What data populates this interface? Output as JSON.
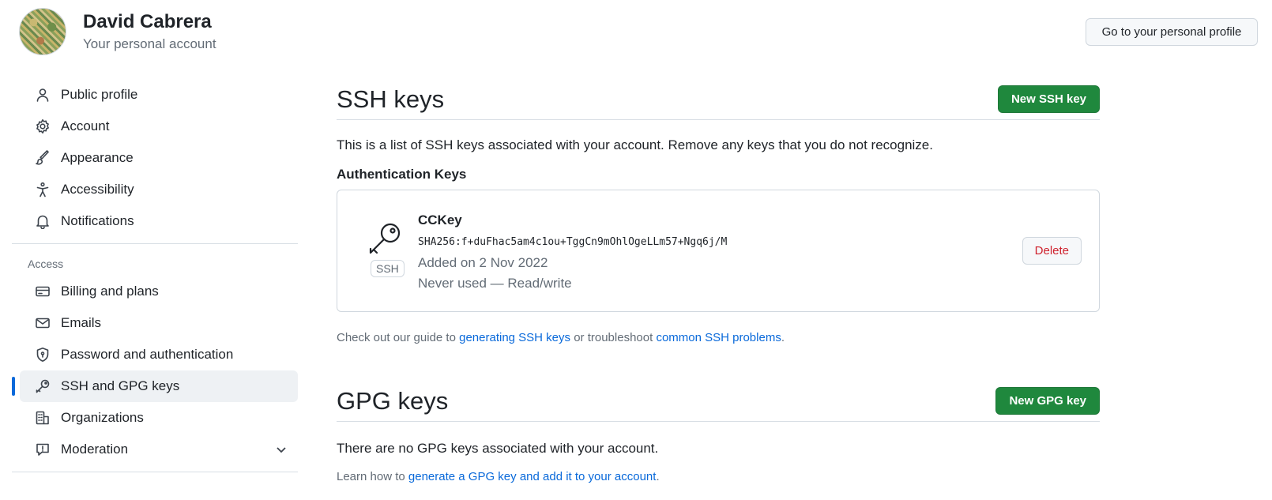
{
  "header": {
    "name": "David Cabrera",
    "subtitle": "Your personal account",
    "profile_button": "Go to your personal profile"
  },
  "sidebar": {
    "items": [
      {
        "label": "Public profile",
        "icon": "person-icon"
      },
      {
        "label": "Account",
        "icon": "gear-icon"
      },
      {
        "label": "Appearance",
        "icon": "paintbrush-icon"
      },
      {
        "label": "Accessibility",
        "icon": "accessibility-icon"
      },
      {
        "label": "Notifications",
        "icon": "bell-icon"
      }
    ],
    "access_heading": "Access",
    "access_items": [
      {
        "label": "Billing and plans",
        "icon": "credit-card-icon"
      },
      {
        "label": "Emails",
        "icon": "mail-icon"
      },
      {
        "label": "Password and authentication",
        "icon": "shield-lock-icon"
      },
      {
        "label": "SSH and GPG keys",
        "icon": "key-icon",
        "active": true
      },
      {
        "label": "Organizations",
        "icon": "organization-icon"
      },
      {
        "label": "Moderation",
        "icon": "report-icon"
      }
    ]
  },
  "ssh": {
    "title": "SSH keys",
    "new_button": "New SSH key",
    "intro": "This is a list of SSH keys associated with your account. Remove any keys that you do not recognize.",
    "auth_heading": "Authentication Keys",
    "key": {
      "badge": "SSH",
      "name": "CCKey",
      "fingerprint": "SHA256:f+duFhac5am4c1ou+TggCn9mOhlOgeLLm57+Ngq6j/M",
      "added": "Added on 2 Nov 2022",
      "usage": "Never used — Read/write",
      "delete_button": "Delete"
    },
    "guide_prefix": "Check out our guide to ",
    "guide_link1": "generating SSH keys",
    "guide_middle": " or troubleshoot ",
    "guide_link2": "common SSH problems",
    "guide_suffix": "."
  },
  "gpg": {
    "title": "GPG keys",
    "new_button": "New GPG key",
    "empty": "There are no GPG keys associated with your account.",
    "learn_prefix": "Learn how to ",
    "learn_link": "generate a GPG key and add it to your account",
    "learn_suffix": "."
  },
  "colors": {
    "accent": "#0969da",
    "primary_button": "#1f883d",
    "danger": "#cf222e"
  }
}
